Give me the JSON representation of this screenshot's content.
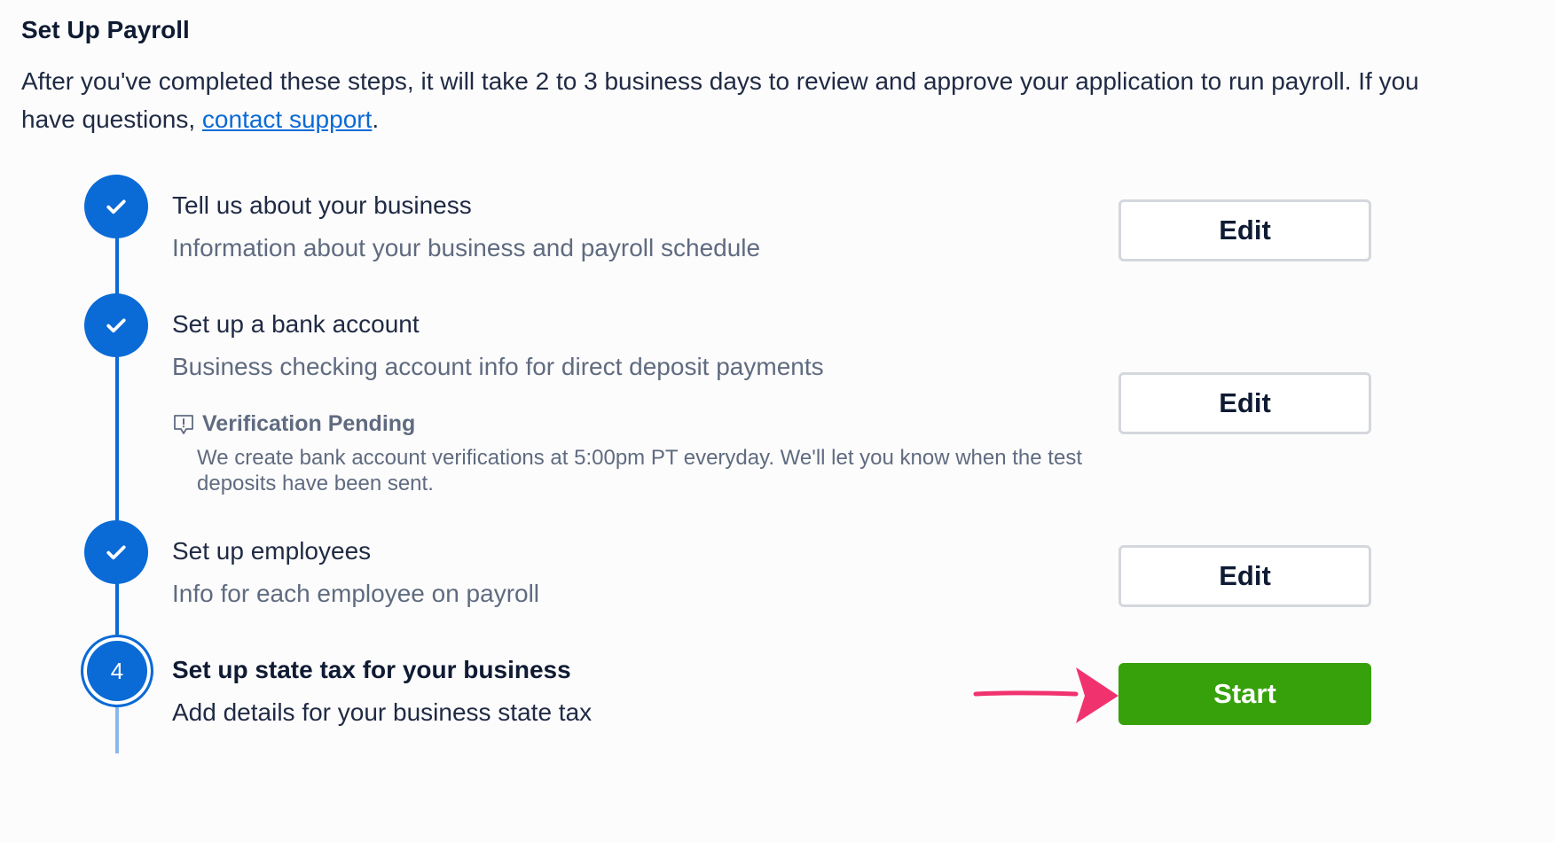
{
  "header": {
    "title": "Set Up Payroll",
    "intro_text": "After you've completed these steps, it will take 2 to 3 business days to review and approve your application to run payroll. If you have questions, ",
    "support_link": "contact support",
    "intro_end": "."
  },
  "steps": [
    {
      "title": "Tell us about your business",
      "description": "Information about your business and payroll schedule",
      "status": "complete",
      "button": "Edit"
    },
    {
      "title": "Set up a bank account",
      "description": "Business checking account info for direct deposit payments",
      "status": "complete",
      "button": "Edit",
      "notice": {
        "title": "Verification Pending",
        "text": "We create bank account verifications at 5:00pm PT everyday. We'll let you know when the test deposits have been sent."
      }
    },
    {
      "title": "Set up employees",
      "description": "Info for each employee on payroll",
      "status": "complete",
      "button": "Edit"
    },
    {
      "number": "4",
      "title": "Set up state tax for your business",
      "description": "Add details for your business state tax",
      "status": "current",
      "button": "Start"
    }
  ],
  "colors": {
    "accent": "#0a6ad6",
    "start_button": "#37a10b",
    "annotation_arrow": "#f0336f"
  }
}
